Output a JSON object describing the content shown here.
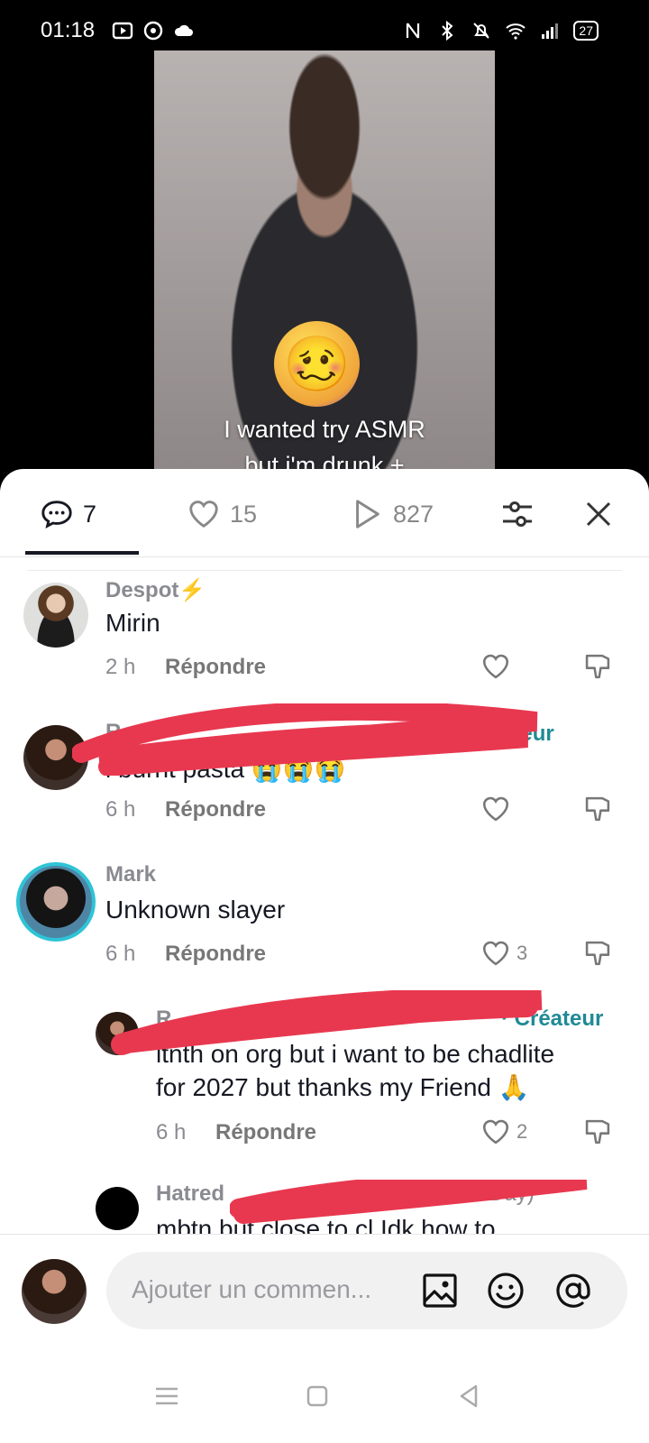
{
  "status_bar": {
    "time": "01:18",
    "battery": "27",
    "icons_left": [
      "video-notification-icon",
      "chat-notification-icon",
      "cloud-icon"
    ],
    "icons_right": [
      "nfc-icon",
      "bluetooth-icon",
      "silent-icon",
      "wifi-icon",
      "signal-icon"
    ]
  },
  "video": {
    "caption_line1": "I wanted try ASMR",
    "caption_line2": "but i'm drunk +",
    "emoji": "🥴"
  },
  "tabs": {
    "comments_count": "7",
    "likes_count": "15",
    "views_count": "827"
  },
  "comments": [
    {
      "username": "Despot⚡",
      "text": "Mirin",
      "time": "2 h",
      "reply_label": "Répondre",
      "likes": ""
    },
    {
      "username": "R",
      "creator_label": "Créateur",
      "text": "i burnt pasta 😭😭😭",
      "time": "6 h",
      "reply_label": "Répondre",
      "likes": ""
    },
    {
      "username": "Mark",
      "text": "Unknown slayer",
      "time": "6 h",
      "reply_label": "Répondre",
      "likes": "3"
    },
    {
      "username": "R",
      "creator_label": "· Créateur",
      "text_line1": "ltnth on org but i want to be chadlite",
      "text_line2": "for 2027 but thanks my Friend 🙏",
      "time": "6 h",
      "reply_label": "Répondre",
      "likes": "2"
    },
    {
      "username": "Hatred",
      "username_suffix": "pes​...eDay)",
      "text": "mbtn but close to cl Idk how to"
    }
  ],
  "composer": {
    "placeholder": "Ajouter un commen...",
    "icons": [
      "image-icon",
      "emoji-icon",
      "mention-icon"
    ]
  },
  "colors": {
    "accent_creator": "#1f8a95",
    "scribble": "#e8384f",
    "sheet_bg": "#ffffff",
    "text_primary": "#161823",
    "text_secondary": "#8a8b91"
  }
}
